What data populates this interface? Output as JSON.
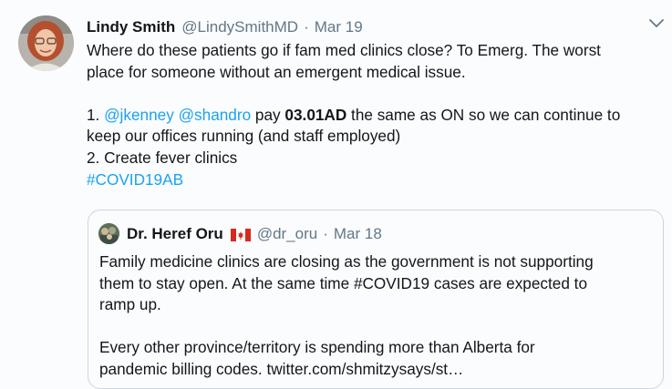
{
  "tweet": {
    "author_name": "Lindy Smith",
    "author_handle": "@LindySmithMD",
    "separator": "·",
    "date": "Mar 19",
    "text_line1": "Where do these patients go if fam med clinics close? To Emerg. The worst",
    "text_line2": "place for someone without an emergent medical issue.",
    "item1_prefix": "1. ",
    "mention1": "@jkenney",
    "mention2": "@shandro",
    "item1_pay": " pay ",
    "item1_code": "03.01AD",
    "item1_rest": " the same as ON so we can continue to",
    "item1_line2": "keep our offices running (and staff employed)",
    "item2": "2. Create fever clinics",
    "hashtag": "#COVID19AB"
  },
  "quoted_tweet": {
    "author_name": "Dr. Heref Oru",
    "author_handle": "@dr_oru",
    "separator": "·",
    "date": "Mar 18",
    "line1": "Family medicine clinics are closing as the government is not supporting",
    "line2": "them to stay open.  At the same time #COVID19 cases are expected to",
    "line3": "ramp up.",
    "line4": "Every other province/territory is spending more than Alberta for",
    "line5": "pandemic billing codes. twitter.com/shmitzysays/st…"
  },
  "icons": {
    "caret": "chevron-down-icon",
    "flag": "canada-flag-icon"
  },
  "colors": {
    "link": "#1da1f2",
    "secondary_text": "#657786",
    "border": "#ccd6dd",
    "background": "#fafcfd"
  }
}
